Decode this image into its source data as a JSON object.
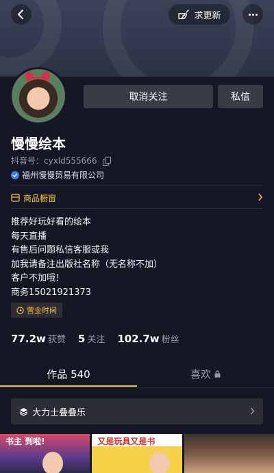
{
  "header": {
    "update_label": "求更新"
  },
  "profile": {
    "name": "慢慢绘本",
    "douyin_id": "抖音号：cyxld555666",
    "verified_org": "福州慢慢贸易有限公司"
  },
  "actions": {
    "unfollow_label": "取消关注",
    "message_label": "私信"
  },
  "shop": {
    "label": "商品橱窗"
  },
  "bio": {
    "lines": [
      "推荐好玩好看的绘本",
      "每天直播",
      "有售后问题私信客服或我",
      "加我请备注出版社名称（无名称不加）",
      "客户不加哦！",
      "商务15021921373"
    ]
  },
  "hours": {
    "label": "营业时间"
  },
  "stats": {
    "likes": {
      "num": "77.2w",
      "label": "获赞"
    },
    "following": {
      "num": "5",
      "label": "关注"
    },
    "followers": {
      "num": "102.7w",
      "label": "粉丝"
    }
  },
  "tabs": {
    "works": "作品 540",
    "likes": "喜欢"
  },
  "collection": {
    "label": "大力士叠叠乐"
  },
  "thumbnails": [
    {
      "text": "书主  到啦!"
    },
    {
      "text": "又是玩具又是书"
    },
    {
      "text": ""
    }
  ],
  "colors": {
    "accent": "#f5c342",
    "background": "#161724",
    "button": "#393b45",
    "verified": "#3a7bf3"
  }
}
